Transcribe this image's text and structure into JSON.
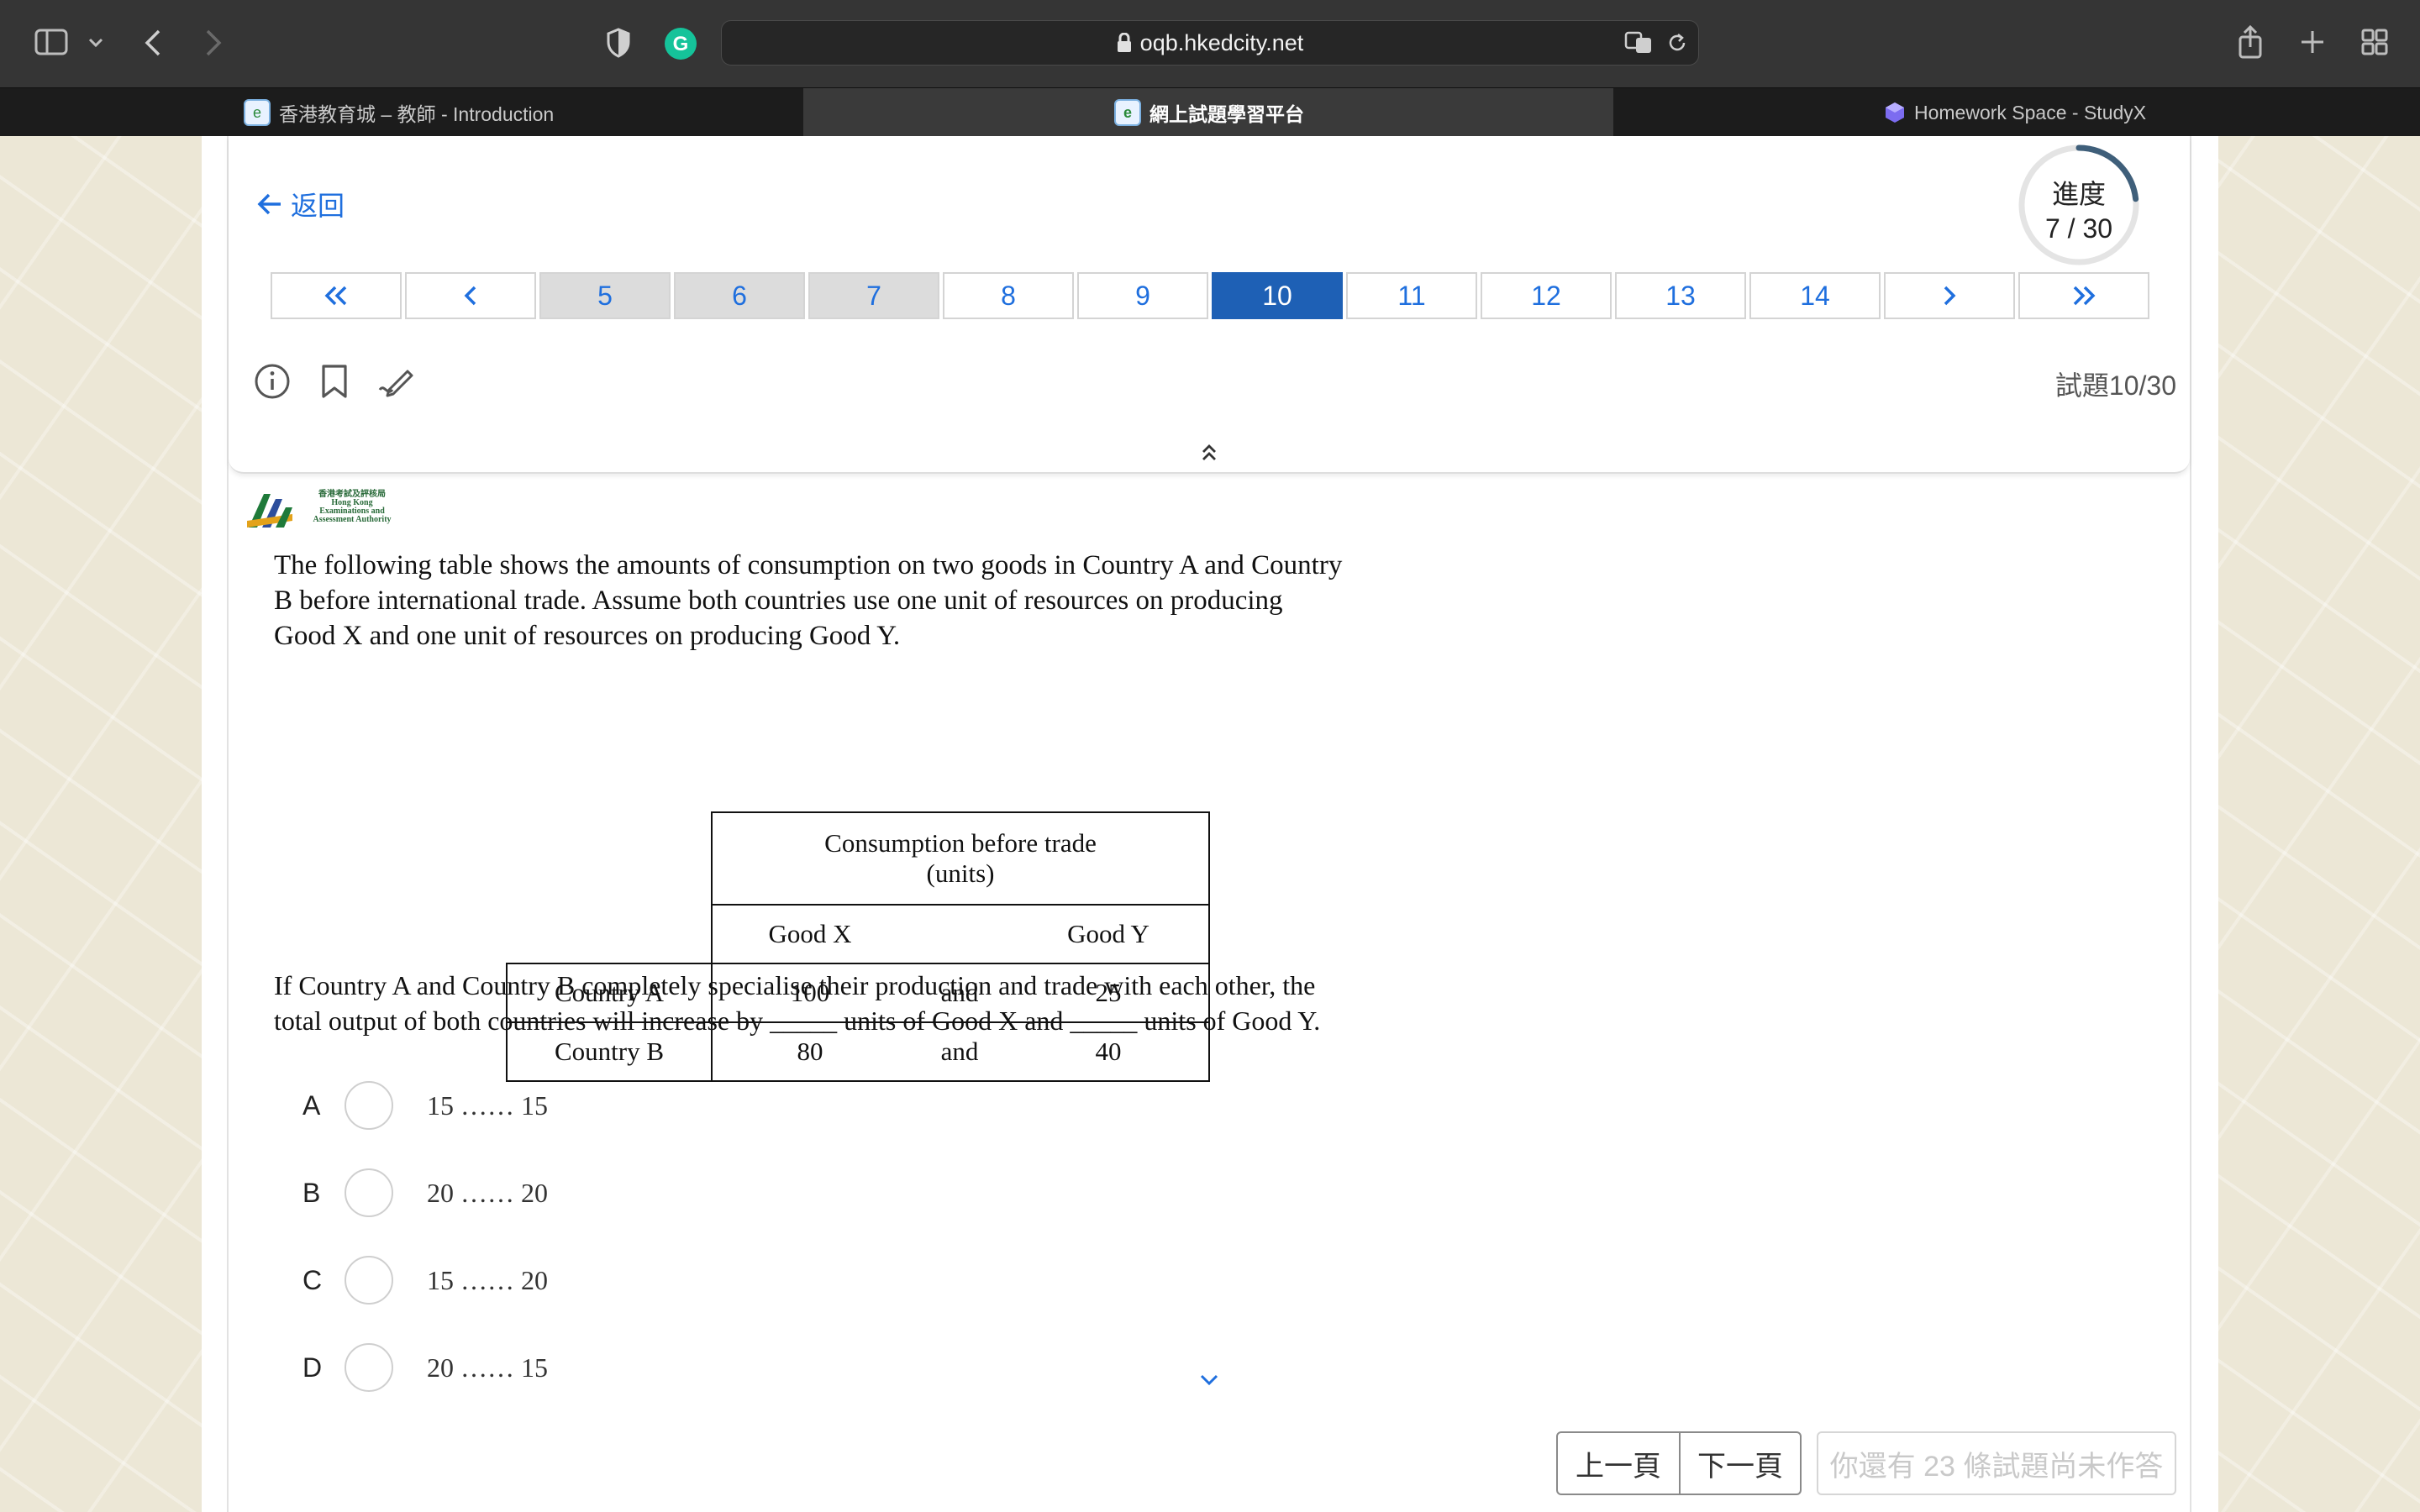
{
  "browser": {
    "url": "oqb.hkedcity.net",
    "tabs": [
      {
        "title": "香港教育城 – 教師 - Introduction",
        "active": false
      },
      {
        "title": "網上試題學習平台",
        "active": true
      },
      {
        "title": "Homework Space - StudyX",
        "active": false
      }
    ],
    "icons": [
      "sidebar-icon",
      "chevron-down-icon",
      "back-icon",
      "forward-icon",
      "privacy-shield-icon",
      "grammarly-icon",
      "lock-icon",
      "translate-icon",
      "reload-icon",
      "share-icon",
      "new-tab-icon",
      "tab-overview-icon"
    ]
  },
  "header": {
    "back_label": "返回",
    "progress_label": "進度",
    "progress_value": "7 / 30",
    "progress_fraction": 0.233,
    "question_counter": "試題10/30",
    "pager": {
      "first": "«",
      "prev": "‹",
      "next": "›",
      "last": "»",
      "pages": [
        {
          "label": "5",
          "state": "answered"
        },
        {
          "label": "6",
          "state": "answered"
        },
        {
          "label": "7",
          "state": "answered"
        },
        {
          "label": "8",
          "state": "unanswered"
        },
        {
          "label": "9",
          "state": "unanswered"
        },
        {
          "label": "10",
          "state": "current"
        },
        {
          "label": "11",
          "state": "unanswered"
        },
        {
          "label": "12",
          "state": "unanswered"
        },
        {
          "label": "13",
          "state": "unanswered"
        },
        {
          "label": "14",
          "state": "unanswered"
        }
      ]
    },
    "tool_icons": [
      "info-icon",
      "bookmark-icon",
      "pen-icon"
    ]
  },
  "question": {
    "logo_text": [
      "香港考試及評核局",
      "Hong Kong",
      "Examinations and",
      "Assessment Authority"
    ],
    "intro_lines": [
      "The following table shows the amounts of consumption on two goods in Country A and Country",
      "B before international trade.  Assume both countries use one unit of resources on producing",
      "Good X and one unit of  resources on producing Good Y."
    ],
    "table": {
      "header_line1": "Consumption before trade",
      "header_line2": "(units)",
      "col_x": "Good X",
      "col_y": "Good Y",
      "rows": [
        {
          "country": "Country A",
          "x": "100",
          "and": "and",
          "y": "25"
        },
        {
          "country": "Country B",
          "x": "80",
          "and": "and",
          "y": "40"
        }
      ]
    },
    "stem_lines": [
      "If Country A and Country B completely specialise their production and trade with each other, the",
      "total output of both countries will increase by _____ units of Good X and _____ units of Good Y."
    ],
    "options": [
      {
        "letter": "A",
        "value": "15 …… 15"
      },
      {
        "letter": "B",
        "value": "20 …… 20"
      },
      {
        "letter": "C",
        "value": "15 …… 20"
      },
      {
        "letter": "D",
        "value": "20 …… 15"
      }
    ]
  },
  "footer": {
    "prev_label": "上一頁",
    "next_label": "下一頁",
    "submit_label": "你還有 23 條試題尚未作答"
  },
  "colors": {
    "accent": "#1f6fde",
    "current_page": "#1e60b5",
    "answered_page": "#dcdcdc",
    "progress_ring": "#3f5f7a"
  }
}
